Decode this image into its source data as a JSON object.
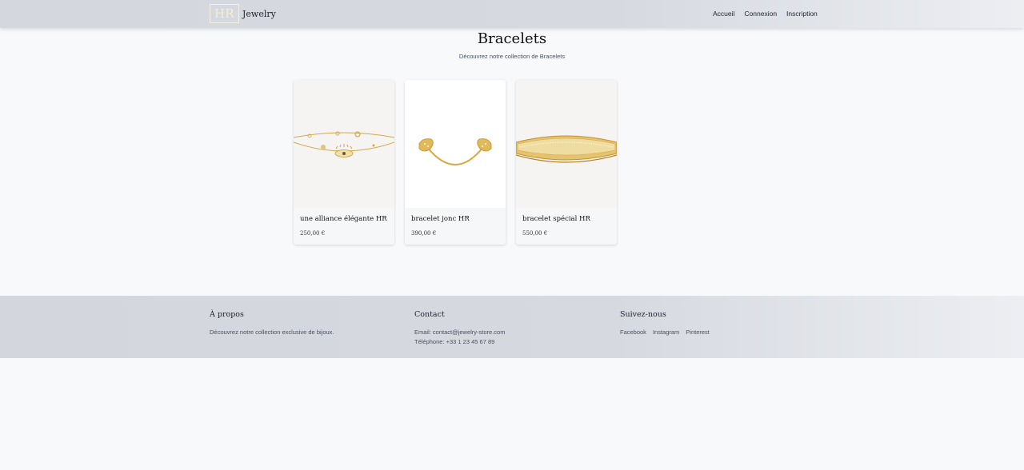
{
  "header": {
    "logo_mark": "HR",
    "logo_text": "Jewelry",
    "nav": [
      "Accueil",
      "Connexion",
      "Inscription"
    ]
  },
  "main": {
    "title": "Bracelets",
    "subtitle": "Découvrez notre collection de Bracelets",
    "products": [
      {
        "name": "une alliance élégante HR",
        "price": "250,00 €",
        "image": "eye-chain-bracelet"
      },
      {
        "name": "bracelet jonc HR",
        "price": "390,00 €",
        "image": "wing-cuff-bracelet"
      },
      {
        "name": "bracelet spécial HR",
        "price": "550,00 €",
        "image": "pave-bangle-bracelet"
      }
    ]
  },
  "footer": {
    "about": {
      "title": "À propos",
      "text": "Découvrez notre collection exclusive de bijoux."
    },
    "contact": {
      "title": "Contact",
      "email": "Email: contact@jewelry-store.com",
      "phone": "Téléphone: +33 1 23 45 67 89"
    },
    "social": {
      "title": "Suivez-nous",
      "links": [
        "Facebook",
        "Instagram",
        "Pinterest"
      ]
    }
  },
  "colors": {
    "gold": "#d9a93a",
    "header_bg": "#d6d9e0"
  }
}
